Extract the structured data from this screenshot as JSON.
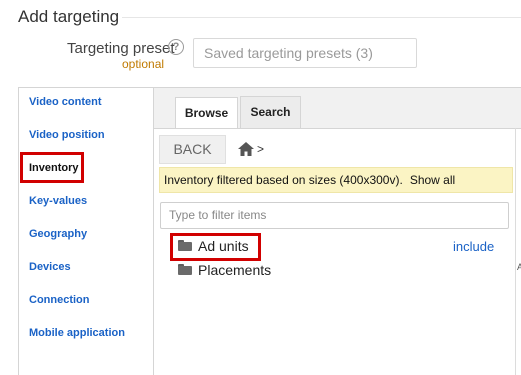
{
  "section": {
    "title": "Add targeting"
  },
  "preset": {
    "label": "Targeting preset",
    "optional": "optional",
    "help_icon": "help-circle-icon",
    "help_glyph": "?",
    "placeholder": "Saved targeting presets (3)"
  },
  "sidebar": {
    "items": [
      {
        "label": "Video content"
      },
      {
        "label": "Video position"
      },
      {
        "label": "Inventory"
      },
      {
        "label": "Key-values"
      },
      {
        "label": "Geography"
      },
      {
        "label": "Devices"
      },
      {
        "label": "Connection"
      },
      {
        "label": "Mobile application"
      }
    ]
  },
  "tabs": [
    {
      "label": "Browse"
    },
    {
      "label": "Search"
    }
  ],
  "browse": {
    "back_label": "BACK",
    "home_icon": "home-icon",
    "crumb_separator": ">",
    "info_text": "Inventory filtered based on sizes (400x300v).",
    "show_all_label": "Show all",
    "filter_placeholder": "Type to filter items",
    "items": [
      {
        "label": "Ad units",
        "icon": "folder-icon"
      },
      {
        "label": "Placements",
        "icon": "folder-icon"
      }
    ],
    "include_label": "include",
    "edge_char": "A"
  },
  "colors": {
    "link": "#1a62c6",
    "highlight": "#d10000",
    "info_bg": "#fbf4c4",
    "optional": "#c07a00"
  }
}
